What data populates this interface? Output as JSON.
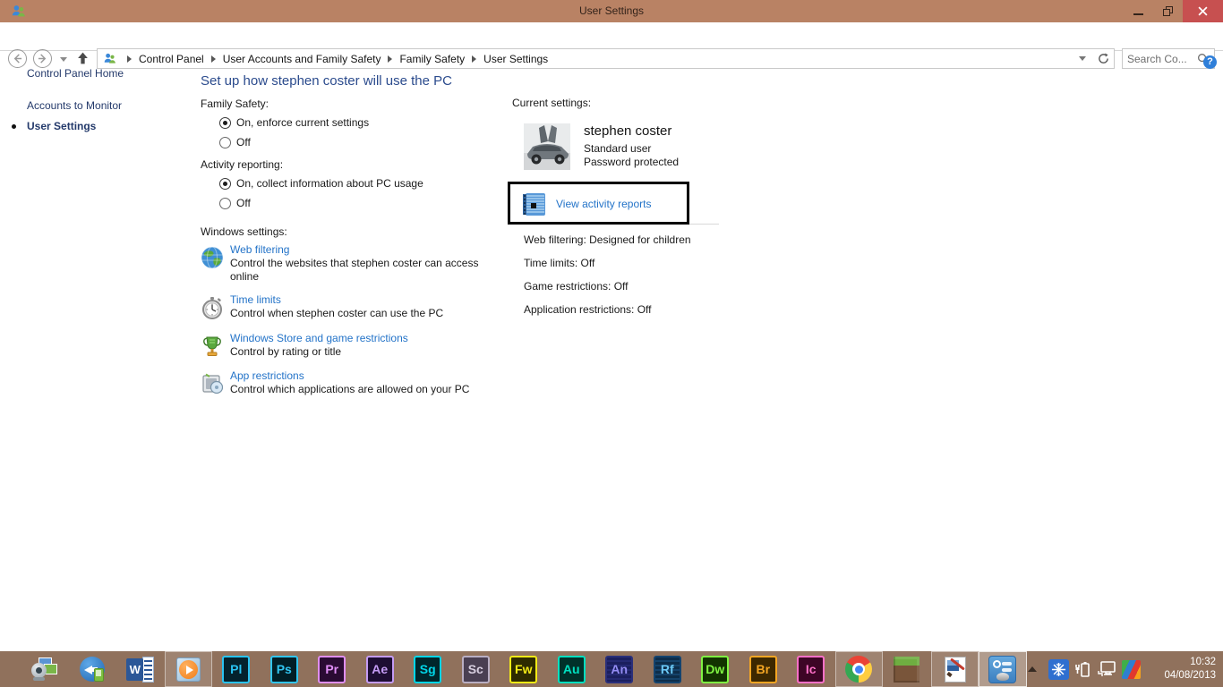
{
  "colors": {
    "titlebar": "#b98264",
    "close_button": "#c75050",
    "taskbar": "#90715c",
    "heading_blue": "#2b4b8d",
    "link_blue": "#2373c8",
    "sidebar_navy": "#243a6b",
    "annotation_border": "#000000"
  },
  "window": {
    "title": "User Settings"
  },
  "navbar": {
    "breadcrumb": [
      "Control Panel",
      "User Accounts and Family Safety",
      "Family Safety",
      "User Settings"
    ],
    "search_placeholder": "Search Co..."
  },
  "icons": {
    "help": "?",
    "word_letter": "W"
  },
  "sidebar": {
    "items": [
      {
        "label": "Control Panel Home",
        "active": false
      },
      {
        "label": "Accounts to Monitor",
        "active": false
      },
      {
        "label": "User Settings",
        "active": true
      }
    ]
  },
  "main": {
    "heading": "Set up how stephen coster will use the PC",
    "family_safety": {
      "label": "Family Safety:",
      "options": [
        {
          "label": "On, enforce current settings",
          "selected": true
        },
        {
          "label": "Off",
          "selected": false
        }
      ]
    },
    "activity_reporting": {
      "label": "Activity reporting:",
      "options": [
        {
          "label": "On, collect information about PC usage",
          "selected": true
        },
        {
          "label": "Off",
          "selected": false
        }
      ]
    },
    "windows_settings": {
      "label": "Windows settings:",
      "items": [
        {
          "icon": "globe-icon",
          "link": "Web filtering",
          "desc": "Control the websites that stephen coster can access online"
        },
        {
          "icon": "stopwatch-icon",
          "link": "Time limits",
          "desc": "Control when stephen coster can use the PC"
        },
        {
          "icon": "trophy-icon",
          "link": "Windows Store and game restrictions",
          "desc": "Control by rating or title"
        },
        {
          "icon": "app-box-icon",
          "link": "App restrictions",
          "desc": "Control which applications are allowed on your PC"
        }
      ]
    }
  },
  "current_settings": {
    "label": "Current settings:",
    "user": {
      "name": "stephen coster",
      "account_type": "Standard user",
      "protection": "Password protected"
    },
    "view_activity_reports": "View activity reports",
    "stats": [
      "Web filtering: Designed for children",
      "Time limits: Off",
      "Game restrictions: Off",
      "Application restrictions: Off"
    ]
  },
  "taskbar": {
    "adobe_labels": [
      "Pl",
      "Ps",
      "Pr",
      "Ae",
      "Sg",
      "Sc",
      "Fw",
      "Au",
      "An",
      "Rf",
      "Dw",
      "Br",
      "Ic"
    ],
    "open_apps": [
      "windows-media-player",
      "chrome",
      "paint",
      "family-safety-settings"
    ],
    "active_app": "family-safety-settings",
    "tray": {
      "time": "10:32",
      "date": "04/08/2013"
    }
  }
}
